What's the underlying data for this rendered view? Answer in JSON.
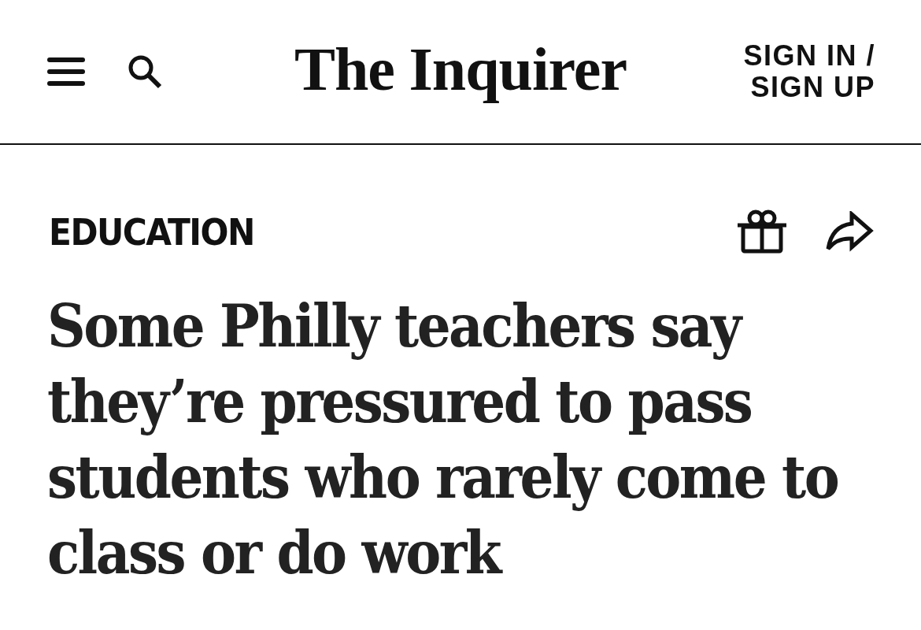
{
  "header": {
    "logo": "The Inquirer",
    "account_link": "SIGN IN / SIGN UP"
  },
  "article": {
    "section": "EDUCATION",
    "headline": "Some Philly teachers say they’re pressured to pass students who rarely come to class or do work"
  }
}
